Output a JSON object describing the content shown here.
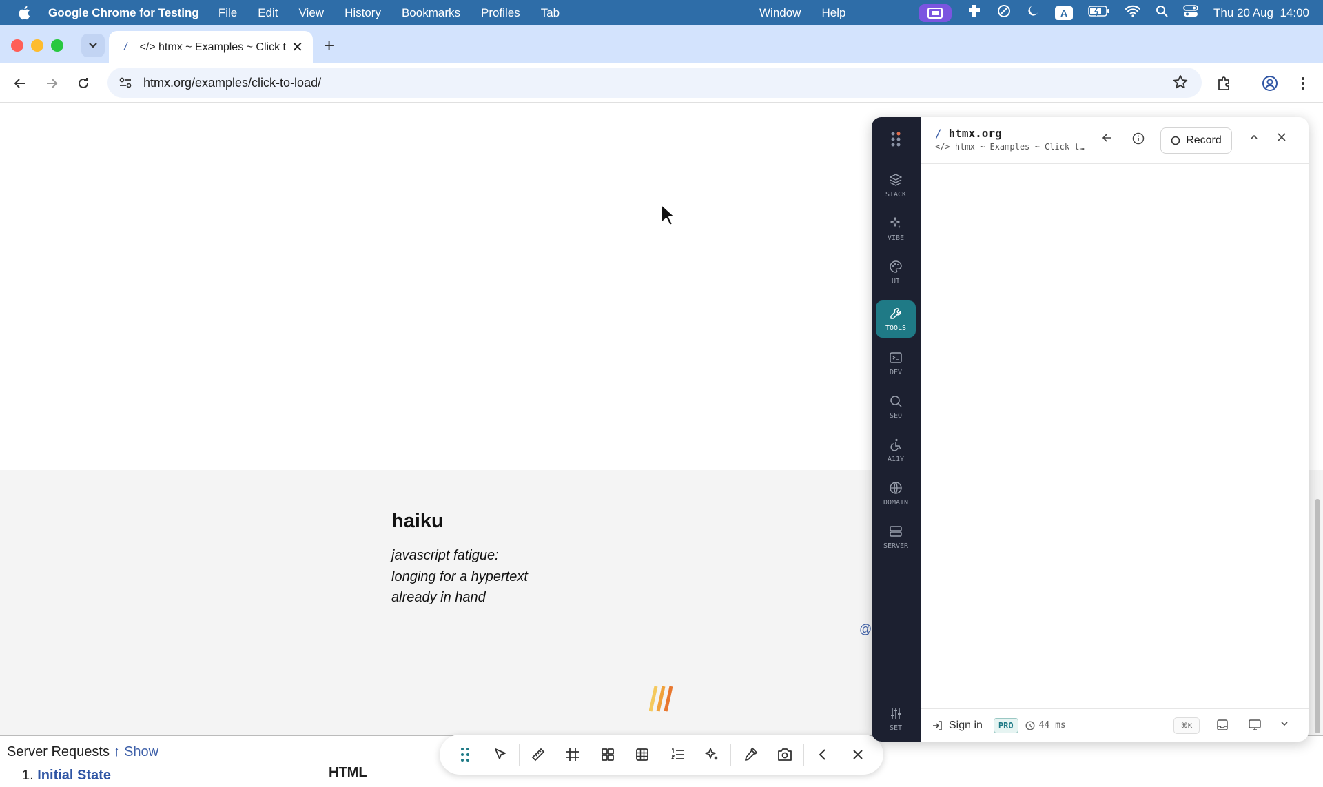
{
  "menubar": {
    "app_name": "Google Chrome for Testing",
    "items": [
      "File",
      "Edit",
      "View",
      "History",
      "Bookmarks",
      "Profiles",
      "Tab"
    ],
    "right_items": [
      "Window",
      "Help"
    ],
    "input_source": "A",
    "datetime": "Thu 20 Aug  14:00"
  },
  "browser": {
    "tab_favicon": "/",
    "tab_title": "</> htmx ~ Examples ~ Click to Load",
    "url": "htmx.org/examples/click-to-load/"
  },
  "page": {
    "haiku_title": "haiku",
    "haiku_lines": [
      "javascript fatigue:",
      "longing for a hypertext",
      "already in hand"
    ],
    "at_sign": "@",
    "server_requests_label": "Server Requests",
    "show_label": "↑ Show",
    "first_request_number": "1.",
    "first_request_label": "Initial State",
    "html_label": "HTML"
  },
  "extension": {
    "host_slash": "/",
    "host": "htmx.org",
    "subtitle": "</> htmx ~ Examples ~ Click to Load",
    "record_label": "Record",
    "sidebar": [
      {
        "label": "STACK",
        "icon": "layers-icon"
      },
      {
        "label": "VIBE",
        "icon": "sparkle-icon"
      },
      {
        "label": "UI",
        "icon": "palette-icon"
      },
      {
        "label": "TOOLS",
        "icon": "wrench-icon",
        "active": true
      },
      {
        "label": "DEV",
        "icon": "terminal-icon"
      },
      {
        "label": "SEO",
        "icon": "search-icon"
      },
      {
        "label": "A11Y",
        "icon": "accessibility-icon"
      },
      {
        "label": "DOMAIN",
        "icon": "globe-icon"
      },
      {
        "label": "SERVER",
        "icon": "server-icon"
      }
    ],
    "settings_label": "SET",
    "signin_label": "Sign in",
    "pro_label": "PRO",
    "timing": "44 ms",
    "shortcut": "⌘K"
  },
  "colors": {
    "menubar": "#2e6da8",
    "tabstrip": "#d3e3fd",
    "accent_teal": "#1f7a86",
    "ext_sidebar": "#1c2030",
    "link_blue": "#2f55a4"
  }
}
